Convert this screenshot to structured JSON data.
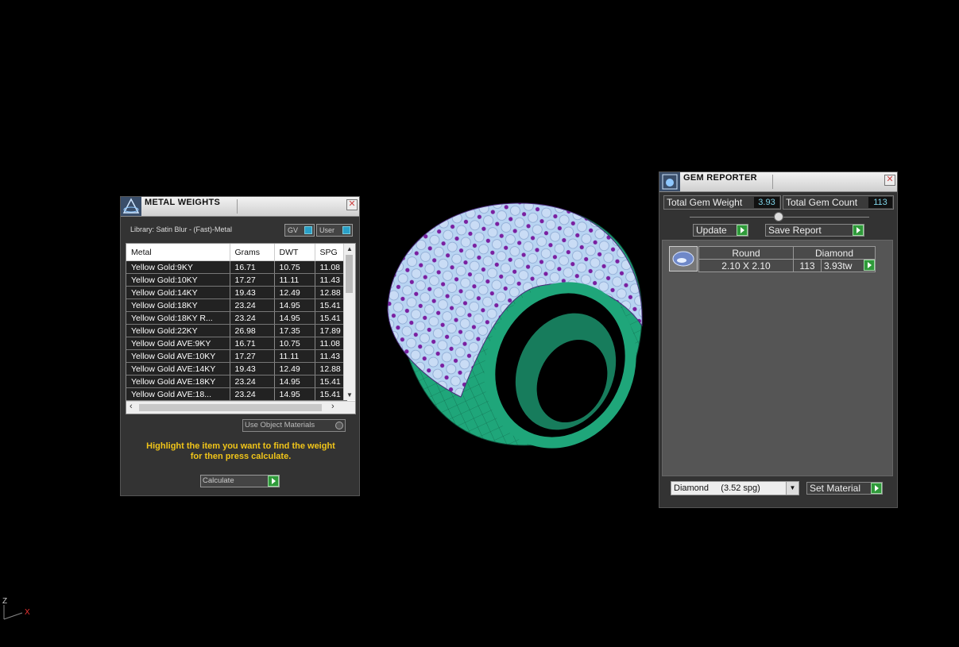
{
  "metal_weights": {
    "title": "METAL WEIGHTS",
    "library": "Library: Satin Blur - (Fast)-Metal",
    "toggle_gv": "GV",
    "toggle_user": "User",
    "columns": [
      "Metal",
      "Grams",
      "DWT",
      "SPG"
    ],
    "rows": [
      [
        "Yellow Gold:9KY",
        "16.71",
        "10.75",
        "11.08"
      ],
      [
        "Yellow Gold:10KY",
        "17.27",
        "11.11",
        "11.43"
      ],
      [
        "Yellow Gold:14KY",
        "19.43",
        "12.49",
        "12.88"
      ],
      [
        "Yellow Gold:18KY",
        "23.24",
        "14.95",
        "15.41"
      ],
      [
        "Yellow Gold:18KY R...",
        "23.24",
        "14.95",
        "15.41"
      ],
      [
        "Yellow Gold:22KY",
        "26.98",
        "17.35",
        "17.89"
      ],
      [
        "Yellow Gold AVE:9KY",
        "16.71",
        "10.75",
        "11.08"
      ],
      [
        "Yellow Gold AVE:10KY",
        "17.27",
        "11.11",
        "11.43"
      ],
      [
        "Yellow Gold AVE:14KY",
        "19.43",
        "12.49",
        "12.88"
      ],
      [
        "Yellow Gold AVE:18KY",
        "23.24",
        "14.95",
        "15.41"
      ],
      [
        "Yellow Gold AVE:18...",
        "23.24",
        "14.95",
        "15.41"
      ]
    ],
    "use_object_materials": "Use Object Materials",
    "hint_line1": "Highlight the item you want to find the weight",
    "hint_line2": "for then press calculate.",
    "calculate_label": "Calculate"
  },
  "gem_reporter": {
    "title": "GEM REPORTER",
    "total_weight_label": "Total Gem Weight",
    "total_weight_value": "3.93",
    "total_count_label": "Total Gem Count",
    "total_count_value": "113",
    "update_label": "Update",
    "save_report_label": "Save Report",
    "gem": {
      "shape": "Round",
      "material": "Diamond",
      "size": "2.10 X 2.10",
      "count": "113",
      "weight": "3.93tw"
    },
    "material_select": "Diamond     (3.52 spg)",
    "set_material_label": "Set Material"
  },
  "viewport": {
    "axis_z": "Z",
    "axis_x": "X",
    "ring_metal_color": "#1fa67a",
    "gem_color": "#b8d4f2",
    "prong_color": "#7a1fa0"
  }
}
